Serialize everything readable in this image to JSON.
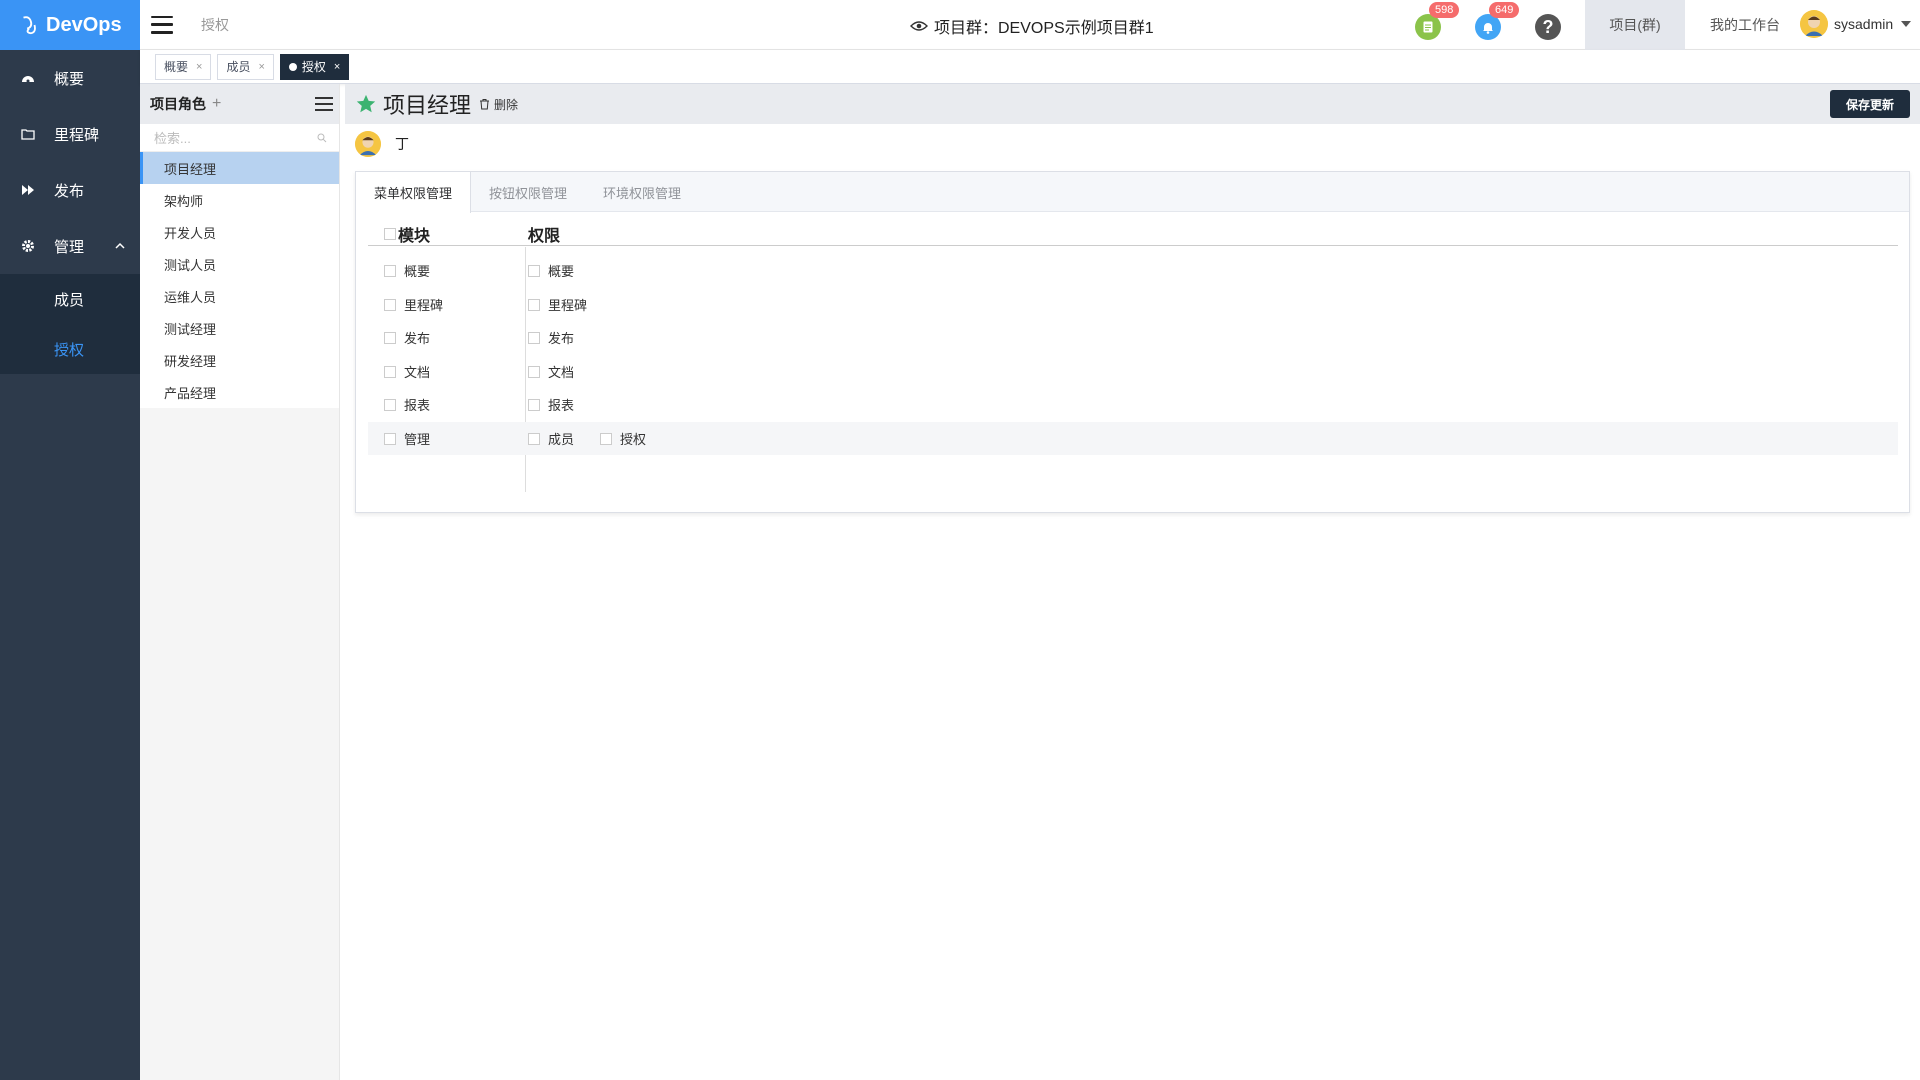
{
  "brand": {
    "name": "DevOps"
  },
  "sidebar": {
    "items": [
      {
        "label": "概要",
        "icon": "dashboard-icon"
      },
      {
        "label": "里程碑",
        "icon": "folder-icon"
      },
      {
        "label": "发布",
        "icon": "fast-forward-icon"
      },
      {
        "label": "管理",
        "icon": "gear-icon"
      }
    ],
    "sub_items": [
      {
        "label": "成员"
      },
      {
        "label": "授权",
        "active": true
      }
    ]
  },
  "header": {
    "breadcrumb": "授权",
    "project_title": "项目群：DEVOPS示例项目群1",
    "doc_badge": "598",
    "bell_badge": "649",
    "help": "?",
    "tab_projects": "项目(群)",
    "tab_workbench": "我的工作台",
    "username": "sysadmin"
  },
  "tags": [
    {
      "label": "概要"
    },
    {
      "label": "成员"
    },
    {
      "label": "授权",
      "active": true
    }
  ],
  "roles": {
    "header": "项目角色",
    "add": "+",
    "search_placeholder": "检索...",
    "items": [
      "项目经理",
      "架构师",
      "开发人员",
      "测试人员",
      "运维人员",
      "测试经理",
      "研发经理",
      "产品经理"
    ],
    "selected": "项目经理"
  },
  "main": {
    "title": "项目经理",
    "delete_label": "删除",
    "save_label": "保存更新",
    "member_name": "丁",
    "tabs": [
      "菜单权限管理",
      "按钮权限管理",
      "环境权限管理"
    ],
    "table": {
      "col_module": "模块",
      "col_perm": "权限",
      "rows": [
        {
          "module": "概要",
          "perms": [
            "概要"
          ]
        },
        {
          "module": "里程碑",
          "perms": [
            "里程碑"
          ]
        },
        {
          "module": "发布",
          "perms": [
            "发布"
          ]
        },
        {
          "module": "文档",
          "perms": [
            "文档"
          ]
        },
        {
          "module": "报表",
          "perms": [
            "报表"
          ]
        },
        {
          "module": "管理",
          "perms": [
            "成员",
            "授权"
          ]
        }
      ]
    }
  },
  "colors": {
    "brand_blue": "#3a94f5",
    "sidebar_bg": "#2d3a4b",
    "active_tag": "#1f2d3d",
    "badge_red": "#f56c6c",
    "star_green": "#3cb371"
  }
}
